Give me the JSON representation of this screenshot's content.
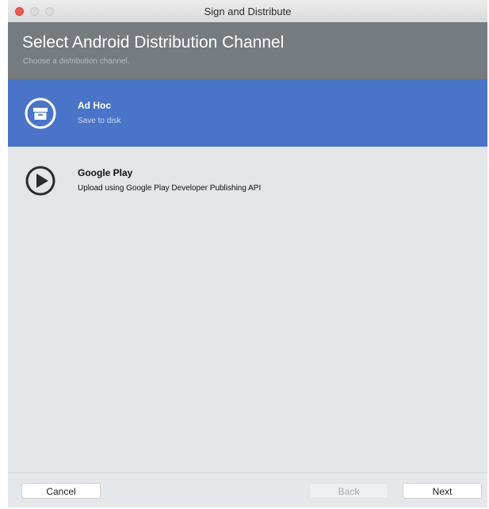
{
  "window": {
    "title": "Sign and Distribute"
  },
  "header": {
    "title": "Select Android Distribution Channel",
    "subtitle": "Choose a distribution channel."
  },
  "channels": [
    {
      "name": "Ad Hoc",
      "description": "Save to disk",
      "icon": "archive-box-icon",
      "selected": true
    },
    {
      "name": "Google Play",
      "description": "Upload using Google Play Developer Publishing API",
      "icon": "play-icon",
      "selected": false
    }
  ],
  "footer": {
    "cancel_label": "Cancel",
    "back_label": "Back",
    "next_label": "Next"
  },
  "colors": {
    "header_bg": "#767b80",
    "selected_bg": "#4a74c7",
    "list_bg": "#e3e5e9",
    "close_button": "#ee5a52"
  }
}
